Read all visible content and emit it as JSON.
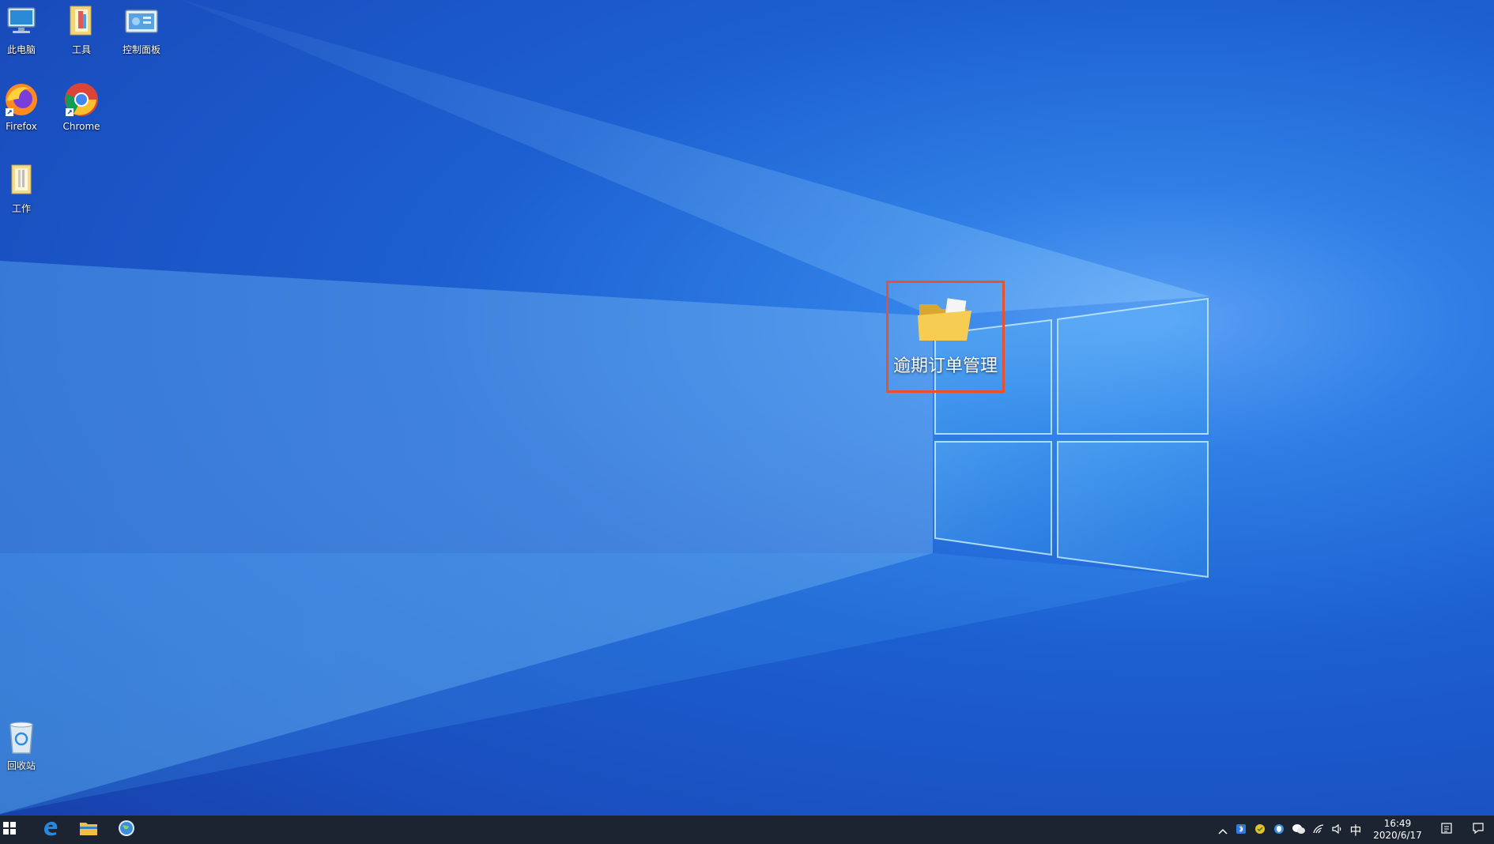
{
  "desktop": {
    "icons": [
      {
        "label": "此电脑"
      },
      {
        "label": "工具"
      },
      {
        "label": "控制面板"
      },
      {
        "label": "Firefox"
      },
      {
        "label": "Chrome"
      },
      {
        "label": "工作"
      },
      {
        "label": "回收站"
      }
    ],
    "highlighted_folder": {
      "label": "逾期订单管理"
    }
  },
  "taskbar": {
    "pinned": [
      "start-icon",
      "edge-icon",
      "file-explorer-icon",
      "globe-icon"
    ],
    "tray": {
      "ime_label": "中",
      "time": "16:49",
      "date": "2020/6/17"
    }
  },
  "colors": {
    "highlight_border": "#e8512d",
    "taskbar_bg": "#1d2431"
  }
}
